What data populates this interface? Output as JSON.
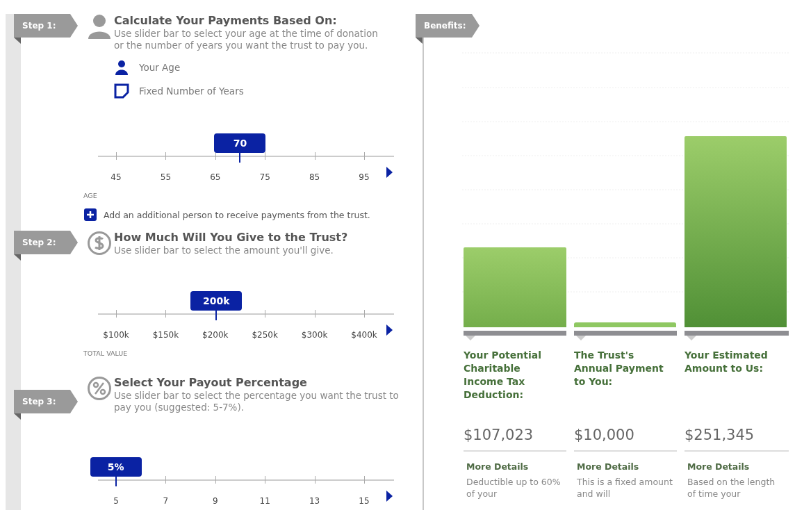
{
  "steps": [
    {
      "tag": "Step 1:",
      "kind": "person",
      "title": "Calculate Your Payments Based On:",
      "description": "Use slider bar to select your age at the time of donation or the number of years you want the trust to pay you.",
      "options": [
        {
          "kind": "person",
          "label": "Your Age"
        },
        {
          "kind": "note",
          "label": "Fixed Number of Years"
        }
      ],
      "slider": {
        "value": "70",
        "level": 0.48,
        "ticks": [
          "45",
          "55",
          "65",
          "75",
          "85",
          "95"
        ],
        "axis_label": "AGE"
      },
      "add_link": "Add an additional person to receive payments from the trust."
    },
    {
      "tag": "Step 2:",
      "kind": "dollar",
      "title": "How Much Will You Give to the Trust?",
      "description": "Use slider bar to select the amount you'll give.",
      "slider": {
        "value": "200k",
        "level": 0.4,
        "ticks": [
          "$100k",
          "$150k",
          "$200k",
          "$250k",
          "$300k",
          "$400k"
        ],
        "axis_label": "TOTAL VALUE"
      }
    },
    {
      "tag": "Step 3:",
      "kind": "percent",
      "title": "Select Your Payout Percentage",
      "description": "Use slider bar to select the percentage you want the trust to pay you (suggested: 5-7%).",
      "slider": {
        "value": "5%",
        "level": 0.06,
        "ticks": [
          "5",
          "7",
          "9",
          "11",
          "13",
          "15"
        ]
      }
    }
  ],
  "benefits": {
    "tag": "Benefits:",
    "items": [
      {
        "title": "Your Potential Charitable Income Tax Deduction:",
        "amount": "$107,023",
        "link": "More Details",
        "details": "Deductible up to 60% of your"
      },
      {
        "title": "The Trust's Annual Payment to You:",
        "amount": "$10,000",
        "link": "More Details",
        "details": "This is a fixed amount and will"
      },
      {
        "title": "Your Estimated Amount to Us:",
        "amount": "$251,345",
        "link": "More Details",
        "details": "Based on the length of time your"
      }
    ]
  }
}
